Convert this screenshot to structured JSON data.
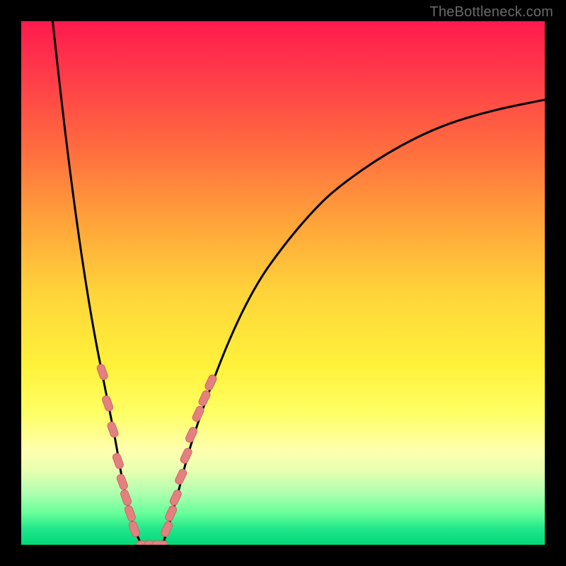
{
  "watermark": "TheBottleneck.com",
  "chart_data": {
    "type": "line",
    "title": "",
    "xlabel": "",
    "ylabel": "",
    "xlim": [
      0,
      100
    ],
    "ylim": [
      0,
      100
    ],
    "grid": false,
    "legend": false,
    "series": [
      {
        "name": "left-branch",
        "x": [
          6,
          8,
          10,
          12,
          14,
          16,
          18,
          19,
          20,
          21,
          22,
          23
        ],
        "y": [
          100,
          82,
          66,
          52,
          40,
          30,
          20,
          14,
          9,
          5,
          2,
          0
        ]
      },
      {
        "name": "right-branch",
        "x": [
          27,
          28,
          30,
          32,
          35,
          40,
          45,
          50,
          55,
          60,
          70,
          80,
          90,
          100
        ],
        "y": [
          0,
          3,
          10,
          18,
          27,
          40,
          50,
          57,
          63,
          68,
          75,
          80,
          83,
          85
        ]
      }
    ],
    "flat_segment": {
      "x": [
        23,
        27
      ],
      "y": 0
    },
    "markers": [
      {
        "branch": "left",
        "x": 15.5,
        "y": 33
      },
      {
        "branch": "left",
        "x": 16.5,
        "y": 27
      },
      {
        "branch": "left",
        "x": 17.5,
        "y": 22
      },
      {
        "branch": "left",
        "x": 18.5,
        "y": 16
      },
      {
        "branch": "left",
        "x": 19.3,
        "y": 12
      },
      {
        "branch": "left",
        "x": 20.0,
        "y": 9
      },
      {
        "branch": "left",
        "x": 20.8,
        "y": 6
      },
      {
        "branch": "left",
        "x": 21.6,
        "y": 3
      },
      {
        "branch": "flat",
        "x": 23.5,
        "y": 0
      },
      {
        "branch": "flat",
        "x": 25.0,
        "y": 0
      },
      {
        "branch": "flat",
        "x": 26.5,
        "y": 0
      },
      {
        "branch": "right",
        "x": 27.8,
        "y": 3
      },
      {
        "branch": "right",
        "x": 28.6,
        "y": 6
      },
      {
        "branch": "right",
        "x": 29.5,
        "y": 9
      },
      {
        "branch": "right",
        "x": 30.5,
        "y": 13
      },
      {
        "branch": "right",
        "x": 31.5,
        "y": 17
      },
      {
        "branch": "right",
        "x": 32.5,
        "y": 21
      },
      {
        "branch": "right",
        "x": 33.8,
        "y": 25
      },
      {
        "branch": "right",
        "x": 35.0,
        "y": 28
      },
      {
        "branch": "right",
        "x": 36.2,
        "y": 31
      }
    ],
    "colors": {
      "curve": "#000000",
      "marker_fill": "#e58080",
      "marker_stroke": "#c96666"
    }
  }
}
